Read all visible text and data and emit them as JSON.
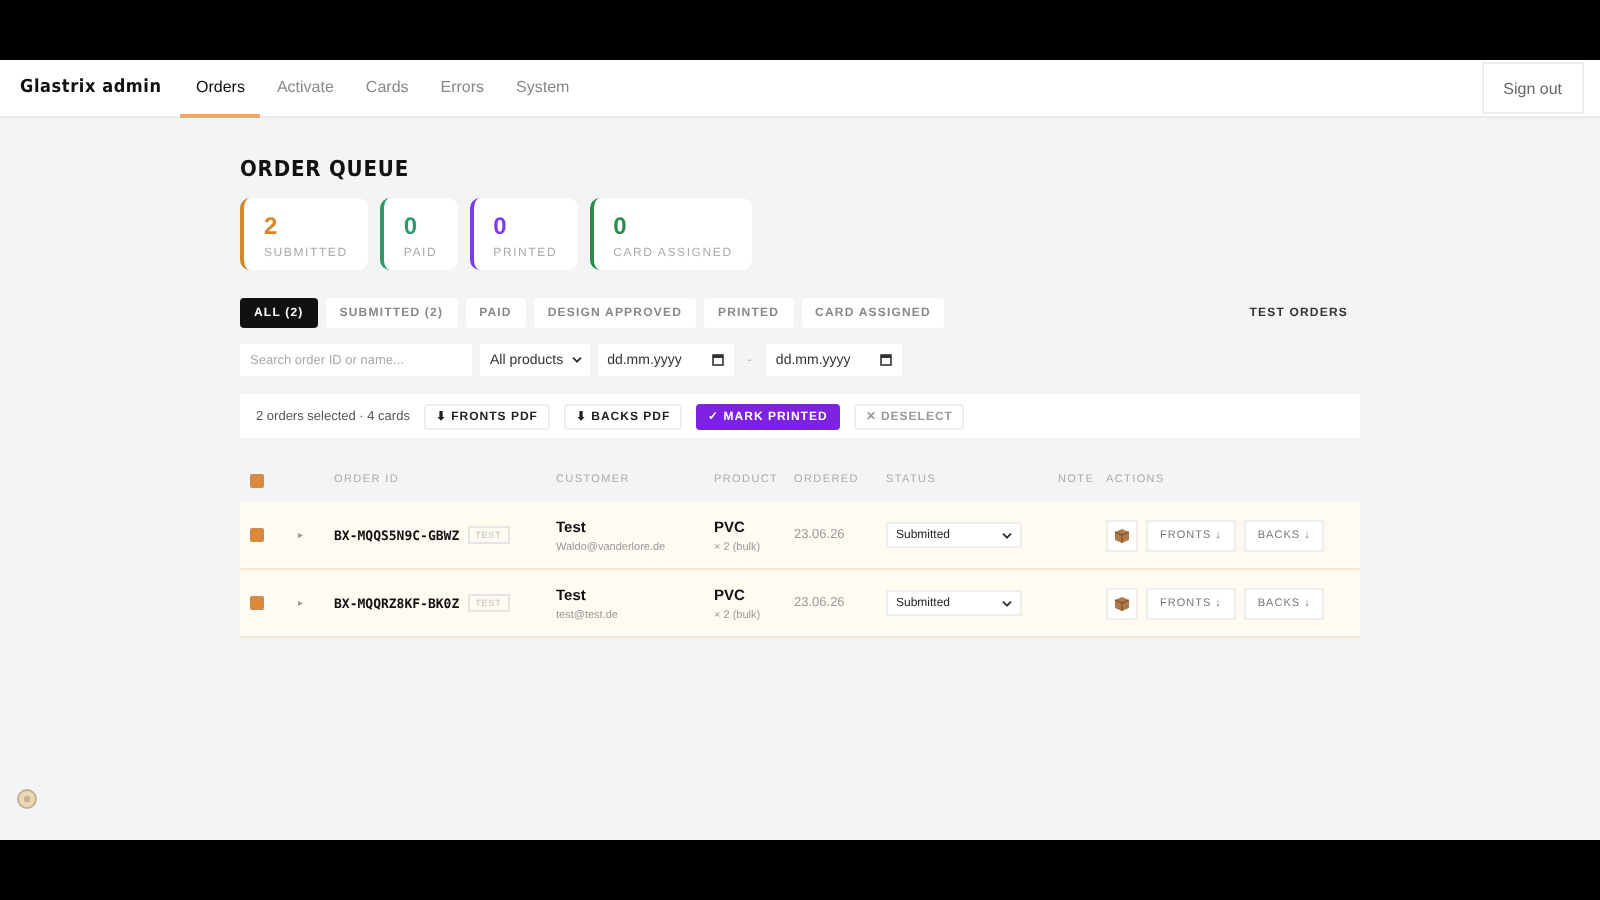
{
  "app": {
    "title": "Glastrix admin",
    "sign_out": "Sign out"
  },
  "nav": [
    {
      "label": "Orders",
      "selected": true
    },
    {
      "label": "Activate",
      "selected": false
    },
    {
      "label": "Cards",
      "selected": false
    },
    {
      "label": "Errors",
      "selected": false
    },
    {
      "label": "System",
      "selected": false
    }
  ],
  "page_title": "ORDER QUEUE",
  "stats": [
    {
      "value": "2",
      "label": "SUBMITTED",
      "color": "#d4862a"
    },
    {
      "value": "0",
      "label": "PAID",
      "color": "#2e9a6a"
    },
    {
      "value": "0",
      "label": "PRINTED",
      "color": "#7c3aed"
    },
    {
      "value": "0",
      "label": "CARD ASSIGNED",
      "color": "#2e8a4a"
    }
  ],
  "filter_tabs": [
    {
      "label": "ALL (2)",
      "selected": true
    },
    {
      "label": "SUBMITTED (2)",
      "selected": false
    },
    {
      "label": "PAID",
      "selected": false
    },
    {
      "label": "DESIGN APPROVED",
      "selected": false
    },
    {
      "label": "PRINTED",
      "selected": false
    },
    {
      "label": "CARD ASSIGNED",
      "selected": false
    }
  ],
  "test_orders": "TEST ORDERS",
  "filters": {
    "search_placeholder": "Search order ID or name...",
    "product": "All products",
    "date_from": "dd.mm.yyyy",
    "date_separator": "-",
    "date_to": "dd.mm.yyyy"
  },
  "selection_bar": {
    "summary": "2 orders selected · 4 cards",
    "buttons": [
      {
        "label": "⬇ FRONTS PDF",
        "kind": "plain"
      },
      {
        "label": "⬇ BACKS PDF",
        "kind": "plain"
      },
      {
        "label": "✓ MARK PRINTED",
        "kind": "primary"
      },
      {
        "label": "✕ DESELECT",
        "kind": "muted"
      }
    ]
  },
  "table": {
    "all_checked": true,
    "columns": [
      "ORDER ID",
      "CUSTOMER",
      "PRODUCT",
      "ORDERED",
      "STATUS",
      "NOTE",
      "ACTIONS"
    ],
    "rows": [
      {
        "checked": true,
        "expander": "▸",
        "order_id": "BX-MQQS5N9C-GBWZ",
        "badge": "TEST",
        "customer": "Test",
        "email": "Waldo@vanderlore.de",
        "product": "PVC",
        "quantity": "× 2 (bulk)",
        "ordered": "23.06.26",
        "status": "Submitted",
        "fronts": "FRONTS ↓",
        "backs": "BACKS ↓"
      },
      {
        "checked": true,
        "expander": "▸",
        "order_id": "BX-MQQRZ8KF-BK0Z",
        "badge": "TEST",
        "customer": "Test",
        "email": "test@test.de",
        "product": "PVC",
        "quantity": "× 2 (bulk)",
        "ordered": "23.06.26",
        "status": "Submitted",
        "fronts": "FRONTS ↓",
        "backs": "BACKS ↓"
      }
    ]
  }
}
